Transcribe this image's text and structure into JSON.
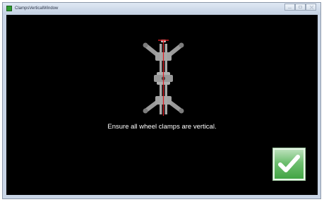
{
  "window": {
    "title": "ClampsVerticalWindow"
  },
  "icons": {
    "app": "app-icon",
    "minimize": "minimize-icon",
    "maximize": "maximize-icon",
    "close": "close-icon",
    "confirm": "checkmark-icon",
    "illustration": "wheel-clamp-icon"
  },
  "content": {
    "instruction": "Ensure all wheel clamps are vertical."
  },
  "colors": {
    "background": "#000000",
    "text": "#ffffff",
    "clamp": "#9a9a9a",
    "vertical_line": "#e31e24",
    "confirm": "#3ea240"
  }
}
